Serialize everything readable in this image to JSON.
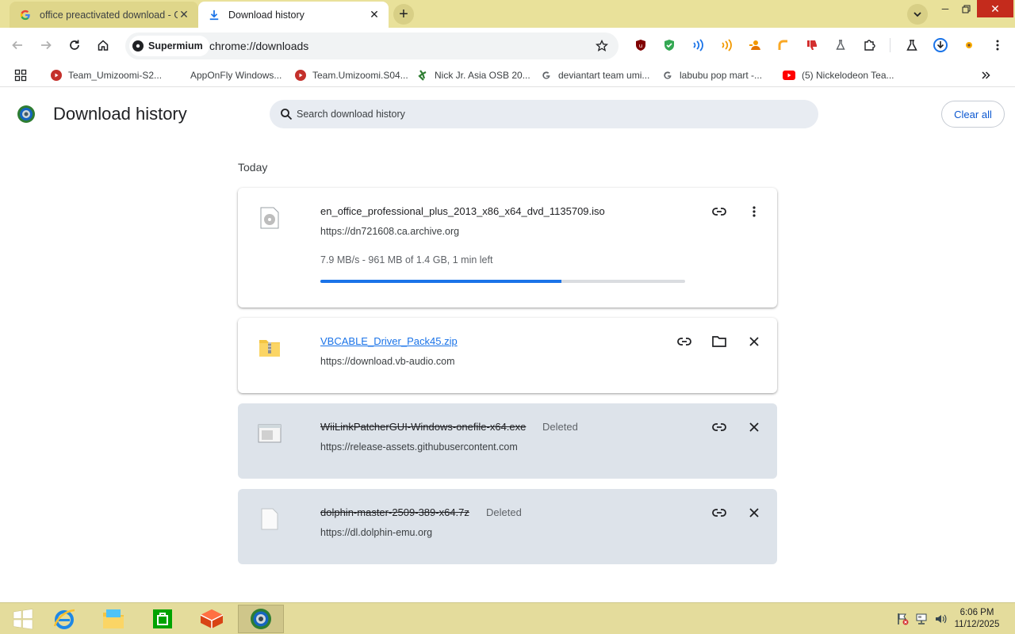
{
  "tabs": [
    {
      "title": "office preactivated download - Goo",
      "icon": "google-g-icon"
    },
    {
      "title": "Download history",
      "icon": "download-icon"
    }
  ],
  "toolbar": {
    "profile_chip": "Supermium",
    "url": "chrome://downloads",
    "extensions": [
      "ublock-origin-icon",
      "shield-check-icon",
      "sound-waves-icon",
      "orange-waves-icon",
      "person-arrow-icon",
      "orange-hook-icon",
      "thumbs-down-icon",
      "flask-chess-icon",
      "puzzle-icon",
      "lab-flask-icon",
      "download-circle-icon",
      "sparkle-icon"
    ]
  },
  "bookmarks": [
    {
      "label": "Team_Umizoomi-S2...",
      "icon": "youtube-icon"
    },
    {
      "label": "AppOnFly Windows...",
      "icon": "blank-icon"
    },
    {
      "label": "Team.Umizoomi.S04...",
      "icon": "youtube-icon"
    },
    {
      "label": "Nick Jr. Asia OSB 20...",
      "icon": "green-figure-icon"
    },
    {
      "label": "deviantart team umi...",
      "icon": "google-g-icon"
    },
    {
      "label": "labubu pop mart -...",
      "icon": "google-g-icon"
    },
    {
      "label": "(5) Nickelodeon Tea...",
      "icon": "youtube-icon"
    }
  ],
  "page": {
    "title": "Download history",
    "search_placeholder": "Search download history",
    "clear_all": "Clear all",
    "section": "Today"
  },
  "downloads": [
    {
      "name": "en_office_professional_plus_2013_x86_x64_dvd_1135709.iso",
      "url": "https://dn721608.ca.archive.org",
      "status": "7.9 MB/s - 961 MB of 1.4 GB, 1 min left",
      "progress": 0.66,
      "state": "in_progress"
    },
    {
      "name": "VBCABLE_Driver_Pack45.zip",
      "url": "https://download.vb-audio.com",
      "state": "complete"
    },
    {
      "name": "WiiLinkPatcherGUI-Windows-onefile-x64.exe",
      "url": "https://release-assets.githubusercontent.com",
      "badge": "Deleted",
      "state": "deleted"
    },
    {
      "name": "dolphin-master-2509-389-x64.7z",
      "url": "https://dl.dolphin-emu.org",
      "badge": "Deleted",
      "state": "deleted"
    }
  ],
  "taskbar": {
    "apps": [
      "start-icon",
      "internet-explorer-icon",
      "file-explorer-icon",
      "store-icon",
      "cube-app-icon",
      "supermium-icon"
    ],
    "time": "6:06 PM",
    "date": "11/12/2025"
  },
  "colors": {
    "tabstrip": "#e9e19a",
    "accent": "#1a73e8",
    "deleted_card": "#dde3ea",
    "taskbar": "#e4dc9c"
  }
}
